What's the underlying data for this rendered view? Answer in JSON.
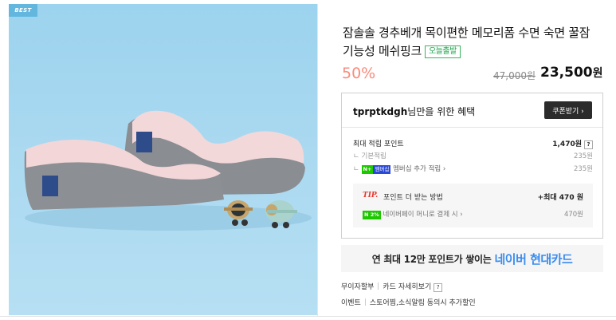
{
  "product": {
    "badge": "BEST",
    "title": "잠솔솔 경추베개 목이편한 메모리폼 수면 숙면 꿀잠 기능성 메쉬핑크",
    "today_badge": "오늘출발",
    "discount": "50%",
    "original_price": "47,000원",
    "sale_price": "23,500",
    "sale_unit": "원"
  },
  "benefits": {
    "user": "tprptkdgh",
    "header_suffix": "님만을 위한 혜택",
    "coupon_button": "쿠폰받기 ›",
    "max_points_label": "최대 적립 포인트",
    "max_points_value": "1,470원",
    "help_mark": "?",
    "basic_label": "기본적립",
    "basic_value": "235원",
    "member_badge_n": "N+",
    "member_badge_text": "멤버십",
    "member_label": "멤버십 추가 적립 ›",
    "member_value": "235원",
    "tip_label": "TIP.",
    "tip_text": "포인트 더 받는 방법",
    "tip_max": "+최대 470 원",
    "pay_badge": "N 2%",
    "pay_label": "네이버페이 머니로 결제 시 ›",
    "pay_value": "470원"
  },
  "promo": {
    "lead": "연 최대 12만 포인트가 쌓이는",
    "brand": "네이버 현대카드"
  },
  "info": {
    "installment_label": "무이자할부",
    "card_detail": "카드 자세히보기",
    "help_mark": "?",
    "event_label": "이벤트",
    "event_text": "스토어찜,소식알림 동의시 추가할인"
  },
  "colors": {
    "discount": "#fa8a7b",
    "photo_bg": "#a8d8f0",
    "promo_brand": "#3a8cf0",
    "today_badge": "#1aa34a"
  }
}
